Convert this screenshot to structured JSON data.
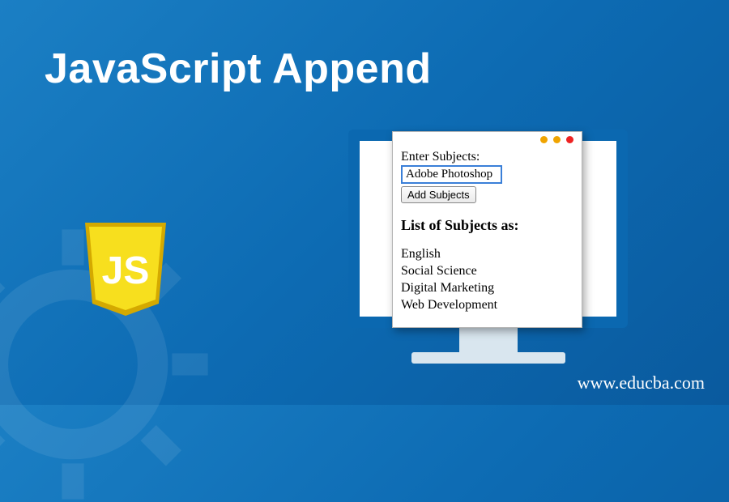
{
  "title": "JavaScript Append",
  "logo": {
    "text": "JS"
  },
  "window": {
    "enter_label": "Enter Subjects:",
    "enter_value": "Adobe Photoshop",
    "add_button": "Add Subjects",
    "list_heading": "List of Subjects as:",
    "subjects": [
      "English",
      "Social Science",
      "Digital Marketing",
      "Web Development"
    ]
  },
  "footer": {
    "url": "www.educba.com"
  },
  "colors": {
    "js_yellow": "#f7df1e",
    "js_shadow": "#d4a900",
    "monitor_border": "#0b68b0"
  }
}
